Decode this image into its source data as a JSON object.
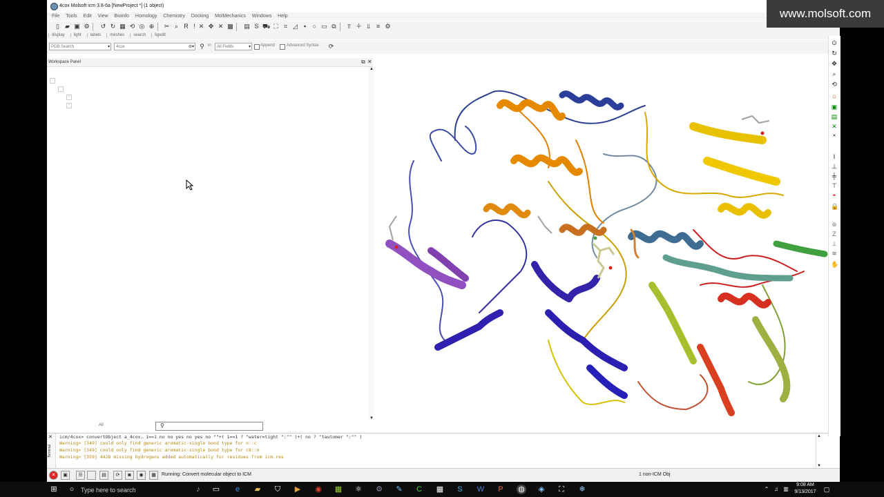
{
  "window": {
    "title": "4cox Molsoft icm 3.8-6a  [NewProject *] (1 object)"
  },
  "menu": [
    "File",
    "Tools",
    "Edit",
    "View",
    "Bioinfo",
    "Homology",
    "Chemistry",
    "Docking",
    "MolMechanics",
    "Windows",
    "Help"
  ],
  "tabs": [
    "display",
    "light",
    "labels",
    "meshes",
    "search",
    "ligedit"
  ],
  "search": {
    "database": "PDB Search",
    "query": "4cox",
    "field": "All Fields",
    "append_label": "Append",
    "advanced_label": "Advanced Syntax"
  },
  "workspace": {
    "title": "Workspace Panel",
    "bottom_tab": "All"
  },
  "terminal": {
    "lines": [
      {
        "text": "icm/4cox> convertObject a_4cox. 1==1 no no yes no yes no \"\"+( 1==1 ? \"water=tight \":\"\" )+( no ? \"tautomer \":\"\" )",
        "color": "#333333"
      },
      {
        "text": "Warning> [349] could only find generic aromatic-single bond type for n::c",
        "color": "#b8860b"
      },
      {
        "text": "Warning> [349] could only find generic aromatic-single bond type for c8::n",
        "color": "#b8860b"
      },
      {
        "text": "Warning> [359] 4428 missing hydrogens added automatically for residues from icm.res",
        "color": "#b8860b"
      }
    ],
    "side_label": "Terminal"
  },
  "status": {
    "message": "Running: Convert molecular object to ICM",
    "objects": "1 non-ICM Obj"
  },
  "taskbar": {
    "search_placeholder": "Type here to search",
    "time": "9:08 AM",
    "date": "9/13/2017"
  },
  "watermark": "www.molsoft.com",
  "colors": {
    "warning": "#b8860b",
    "taskbar": "#0d0d0d"
  }
}
